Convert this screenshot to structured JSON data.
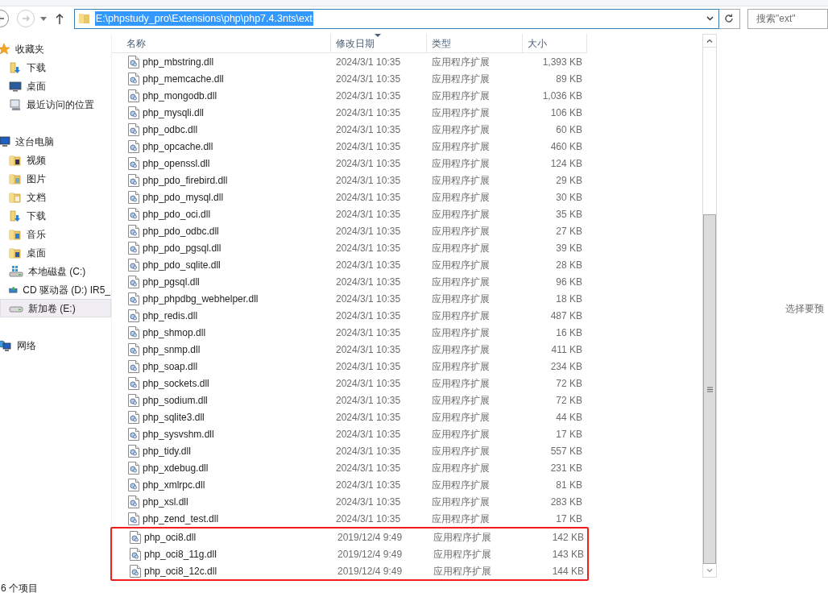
{
  "toolbar": {
    "address": {
      "value": "E:\\phpstudy_pro\\Extensions\\php\\php7.4.3nts\\ext",
      "selected": true
    },
    "search": {
      "placeholder": "搜索\"ext\""
    }
  },
  "sidebar": {
    "groups": [
      {
        "label": "收藏夹",
        "kind": "star",
        "children": [
          {
            "label": "下载",
            "kind": "folder-download",
            "selected": false
          },
          {
            "label": "桌面",
            "kind": "desktop",
            "selected": false
          },
          {
            "label": "最近访问的位置",
            "kind": "recent",
            "selected": false
          }
        ]
      },
      {
        "label": "这台电脑",
        "kind": "computer",
        "children": [
          {
            "label": "视频",
            "kind": "folder-video",
            "selected": false
          },
          {
            "label": "图片",
            "kind": "folder-picture",
            "selected": false
          },
          {
            "label": "文档",
            "kind": "folder-document",
            "selected": false
          },
          {
            "label": "下载",
            "kind": "folder-download",
            "selected": false
          },
          {
            "label": "音乐",
            "kind": "folder-music",
            "selected": false
          },
          {
            "label": "桌面",
            "kind": "folder-desktop",
            "selected": false
          },
          {
            "label": "本地磁盘 (C:)",
            "kind": "system-drive",
            "selected": false
          },
          {
            "label": "CD 驱动器 (D:) IR5_",
            "kind": "cd-drive",
            "selected": false
          },
          {
            "label": "新加卷 (E:)",
            "kind": "drive",
            "selected": true
          }
        ]
      },
      {
        "label": "网络",
        "kind": "network"
      }
    ]
  },
  "table": {
    "columns": [
      {
        "label": "名称",
        "sorted": false
      },
      {
        "label": "修改日期",
        "sorted": true
      },
      {
        "label": "类型",
        "sorted": false
      },
      {
        "label": "大小",
        "sorted": false
      }
    ],
    "rows": [
      {
        "name": "php_mbstring.dll",
        "date": "2024/3/1 10:35",
        "type": "应用程序扩展",
        "size": "1,393 KB"
      },
      {
        "name": "php_memcache.dll",
        "date": "2024/3/1 10:35",
        "type": "应用程序扩展",
        "size": "89 KB"
      },
      {
        "name": "php_mongodb.dll",
        "date": "2024/3/1 10:35",
        "type": "应用程序扩展",
        "size": "1,036 KB"
      },
      {
        "name": "php_mysqli.dll",
        "date": "2024/3/1 10:35",
        "type": "应用程序扩展",
        "size": "106 KB"
      },
      {
        "name": "php_odbc.dll",
        "date": "2024/3/1 10:35",
        "type": "应用程序扩展",
        "size": "60 KB"
      },
      {
        "name": "php_opcache.dll",
        "date": "2024/3/1 10:35",
        "type": "应用程序扩展",
        "size": "460 KB"
      },
      {
        "name": "php_openssl.dll",
        "date": "2024/3/1 10:35",
        "type": "应用程序扩展",
        "size": "124 KB"
      },
      {
        "name": "php_pdo_firebird.dll",
        "date": "2024/3/1 10:35",
        "type": "应用程序扩展",
        "size": "29 KB"
      },
      {
        "name": "php_pdo_mysql.dll",
        "date": "2024/3/1 10:35",
        "type": "应用程序扩展",
        "size": "30 KB"
      },
      {
        "name": "php_pdo_oci.dll",
        "date": "2024/3/1 10:35",
        "type": "应用程序扩展",
        "size": "35 KB"
      },
      {
        "name": "php_pdo_odbc.dll",
        "date": "2024/3/1 10:35",
        "type": "应用程序扩展",
        "size": "27 KB"
      },
      {
        "name": "php_pdo_pgsql.dll",
        "date": "2024/3/1 10:35",
        "type": "应用程序扩展",
        "size": "39 KB"
      },
      {
        "name": "php_pdo_sqlite.dll",
        "date": "2024/3/1 10:35",
        "type": "应用程序扩展",
        "size": "28 KB"
      },
      {
        "name": "php_pgsql.dll",
        "date": "2024/3/1 10:35",
        "type": "应用程序扩展",
        "size": "96 KB"
      },
      {
        "name": "php_phpdbg_webhelper.dll",
        "date": "2024/3/1 10:35",
        "type": "应用程序扩展",
        "size": "18 KB"
      },
      {
        "name": "php_redis.dll",
        "date": "2024/3/1 10:35",
        "type": "应用程序扩展",
        "size": "487 KB"
      },
      {
        "name": "php_shmop.dll",
        "date": "2024/3/1 10:35",
        "type": "应用程序扩展",
        "size": "16 KB"
      },
      {
        "name": "php_snmp.dll",
        "date": "2024/3/1 10:35",
        "type": "应用程序扩展",
        "size": "411 KB"
      },
      {
        "name": "php_soap.dll",
        "date": "2024/3/1 10:35",
        "type": "应用程序扩展",
        "size": "234 KB"
      },
      {
        "name": "php_sockets.dll",
        "date": "2024/3/1 10:35",
        "type": "应用程序扩展",
        "size": "72 KB"
      },
      {
        "name": "php_sodium.dll",
        "date": "2024/3/1 10:35",
        "type": "应用程序扩展",
        "size": "72 KB"
      },
      {
        "name": "php_sqlite3.dll",
        "date": "2024/3/1 10:35",
        "type": "应用程序扩展",
        "size": "44 KB"
      },
      {
        "name": "php_sysvshm.dll",
        "date": "2024/3/1 10:35",
        "type": "应用程序扩展",
        "size": "17 KB"
      },
      {
        "name": "php_tidy.dll",
        "date": "2024/3/1 10:35",
        "type": "应用程序扩展",
        "size": "557 KB"
      },
      {
        "name": "php_xdebug.dll",
        "date": "2024/3/1 10:35",
        "type": "应用程序扩展",
        "size": "231 KB"
      },
      {
        "name": "php_xmlrpc.dll",
        "date": "2024/3/1 10:35",
        "type": "应用程序扩展",
        "size": "81 KB"
      },
      {
        "name": "php_xsl.dll",
        "date": "2024/3/1 10:35",
        "type": "应用程序扩展",
        "size": "283 KB"
      },
      {
        "name": "php_zend_test.dll",
        "date": "2024/3/1 10:35",
        "type": "应用程序扩展",
        "size": "17 KB"
      }
    ],
    "outlined_rows": [
      {
        "name": "php_oci8.dll",
        "date": "2019/12/4 9:49",
        "type": "应用程序扩展",
        "size": "142 KB"
      },
      {
        "name": "php_oci8_11g.dll",
        "date": "2019/12/4 9:49",
        "type": "应用程序扩展",
        "size": "143 KB"
      },
      {
        "name": "php_oci8_12c.dll",
        "date": "2019/12/4 9:49",
        "type": "应用程序扩展",
        "size": "144 KB"
      }
    ]
  },
  "preview": {
    "message": "选择要预"
  },
  "status_bar": {
    "item_count": "6 个项目"
  }
}
